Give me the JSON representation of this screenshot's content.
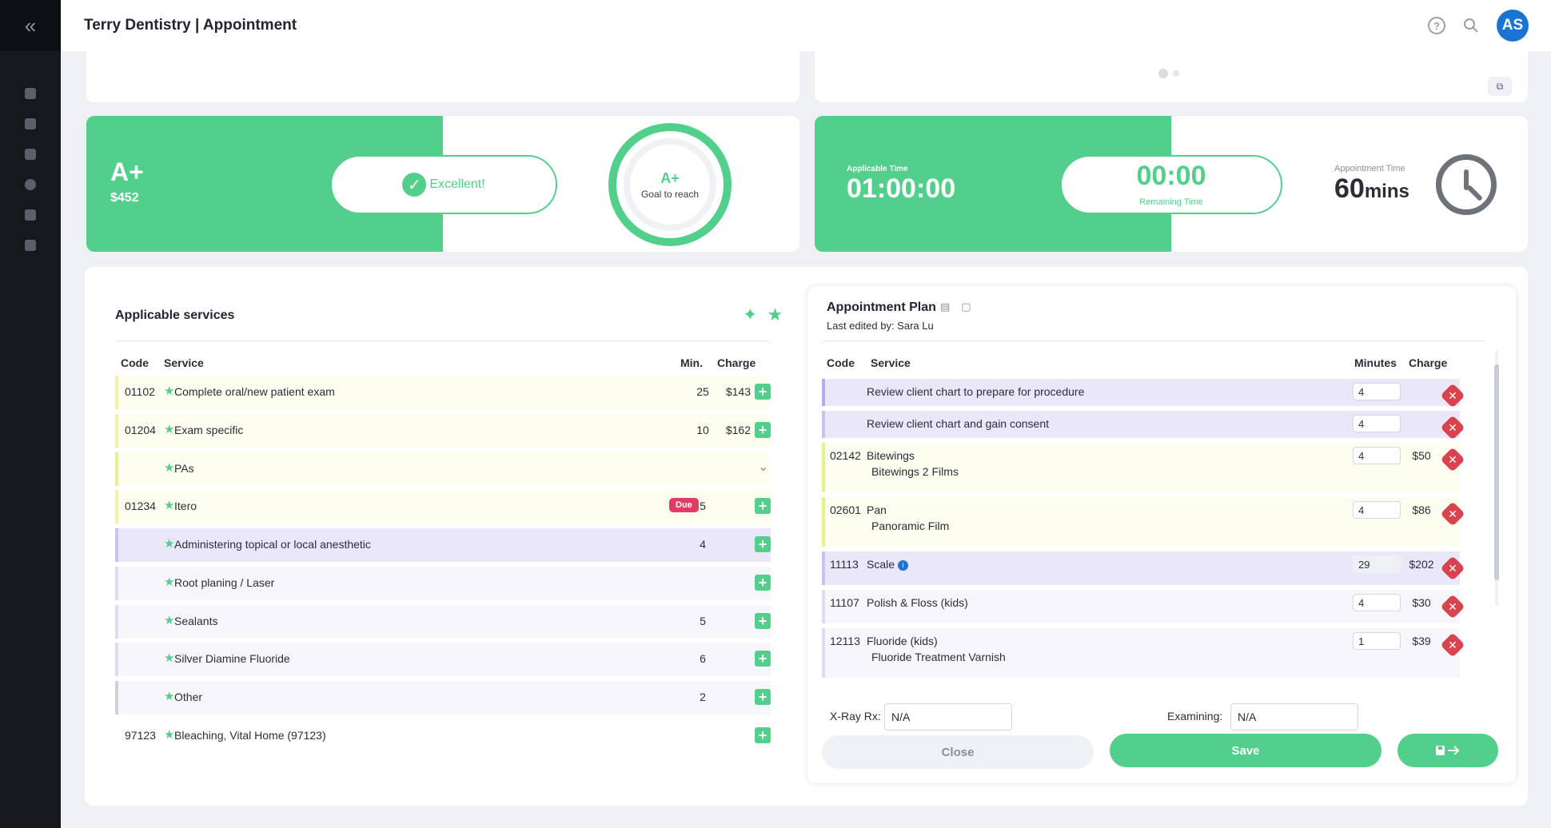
{
  "header": {
    "title": "Terry Dentistry | Appointment",
    "avatar": "AS"
  },
  "sidebar": {
    "collapse_glyph": "«"
  },
  "colors": {
    "accent": "#52cf8a",
    "danger": "#d9434d",
    "due": "#e23a63",
    "avatar": "#1a74d4"
  },
  "score": {
    "grade": "A+",
    "amount": "$452",
    "status": "Excellent!",
    "goal_grade": "A+",
    "goal_label": "Goal to reach"
  },
  "time": {
    "applicable_label": "Applicable Time",
    "applicable_value": "01:00:00",
    "remaining_value": "00:00",
    "remaining_label": "Remaining Time",
    "appointment_label": "Appointment Time",
    "appointment_value": "60",
    "appointment_unit": "mins"
  },
  "services": {
    "title": "Applicable services",
    "headers": {
      "code": "Code",
      "service": "Service",
      "min": "Min.",
      "charge": "Charge"
    },
    "rows": [
      {
        "code": "01102",
        "service": "Complete oral/new patient exam",
        "min": "25",
        "charge": "$143"
      },
      {
        "code": "01204",
        "service": "Exam specific",
        "min": "10",
        "charge": "$162"
      },
      {
        "code": "",
        "service": "PAs",
        "min": "",
        "charge": ""
      },
      {
        "code": "01234",
        "service": "Itero",
        "badge": "Due",
        "min": "5",
        "charge": ""
      },
      {
        "code": "",
        "service": "Administering topical or local anesthetic",
        "min": "4",
        "charge": ""
      },
      {
        "code": "",
        "service": "Root planing / Laser",
        "min": "",
        "charge": ""
      },
      {
        "code": "",
        "service": "Sealants",
        "min": "5",
        "charge": ""
      },
      {
        "code": "",
        "service": "Silver Diamine Fluoride",
        "min": "6",
        "charge": ""
      },
      {
        "code": "",
        "service": "Other",
        "min": "2",
        "charge": ""
      },
      {
        "code": "97123",
        "service": "Bleaching, Vital Home (97123)",
        "min": "",
        "charge": ""
      }
    ]
  },
  "plan": {
    "title": "Appointment Plan",
    "last_edited": "Last edited by: Sara Lu",
    "headers": {
      "code": "Code",
      "service": "Service",
      "minutes": "Minutes",
      "charge": "Charge"
    },
    "rows": [
      {
        "code": "",
        "service": "Review client chart to prepare for procedure",
        "sub": "",
        "minutes": "4",
        "charge": ""
      },
      {
        "code": "",
        "service": "Review client chart and gain consent",
        "sub": "",
        "minutes": "4",
        "charge": ""
      },
      {
        "code": "02142",
        "service": "Bitewings",
        "sub": "Bitewings 2 Films",
        "minutes": "4",
        "charge": "$50"
      },
      {
        "code": "02601",
        "service": "Pan",
        "sub": "Panoramic Film",
        "minutes": "4",
        "charge": "$86"
      },
      {
        "code": "11113",
        "service": "Scale",
        "sub": "",
        "minutes": "29",
        "charge": "$202"
      },
      {
        "code": "11107",
        "service": "Polish & Floss (kids)",
        "sub": "",
        "minutes": "4",
        "charge": "$30"
      },
      {
        "code": "12113",
        "service": "Fluoride (kids)",
        "sub": "Fluoride Treatment Varnish",
        "minutes": "1",
        "charge": "$39"
      }
    ],
    "xray_label": "X-Ray Rx:",
    "xray_value": "N/A",
    "examining_label": "Examining:",
    "examining_value": "N/A",
    "close_label": "Close",
    "save_label": "Save"
  }
}
